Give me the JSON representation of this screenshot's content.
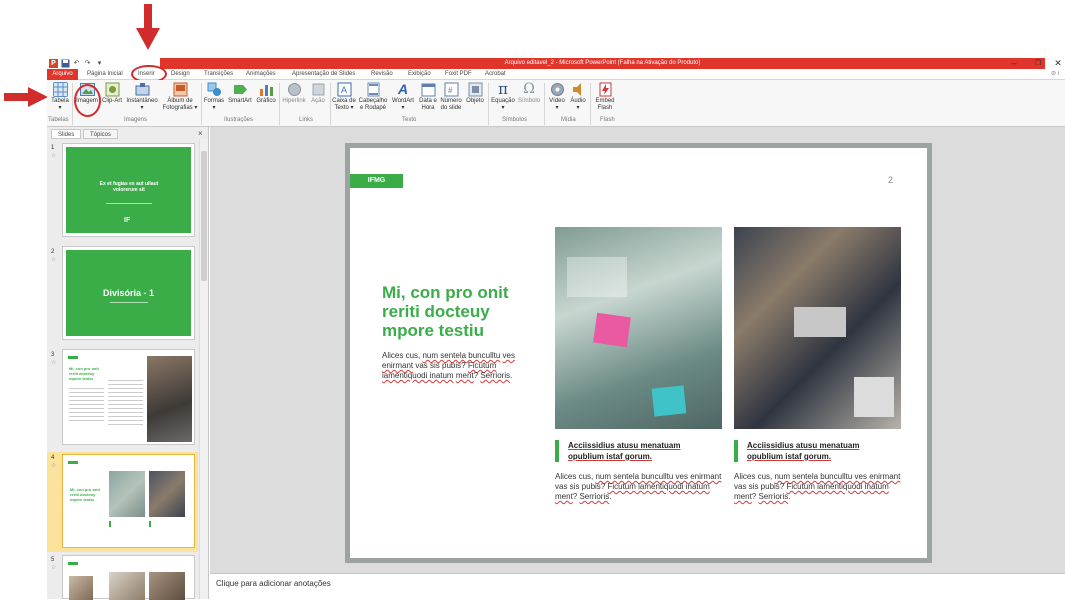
{
  "titlebar": {
    "title": "Arquivo editavel_2 - Microsoft PowerPoint (Falha na Ativação do Produto)",
    "icon_label": "P",
    "window_controls": [
      "–",
      "❐",
      "✕"
    ]
  },
  "tabs": [
    {
      "label": "Arquivo"
    },
    {
      "label": "Página Inicial"
    },
    {
      "label": "Inserir"
    },
    {
      "label": "Design"
    },
    {
      "label": "Transições"
    },
    {
      "label": "Animações"
    },
    {
      "label": "Apresentação de Slides"
    },
    {
      "label": "Revisão"
    },
    {
      "label": "Exibição"
    },
    {
      "label": "Foxit PDF"
    },
    {
      "label": "Acrobat"
    }
  ],
  "ribbon": {
    "buttons": [
      {
        "label": "Tabela",
        "sub": "▾",
        "icon": "table-icon",
        "color": "#5b8fc7"
      },
      {
        "label": "Imagem",
        "sub": "",
        "icon": "picture-icon",
        "color": "#6fa0d6"
      },
      {
        "label": "Clip-Art",
        "sub": "",
        "icon": "clipart-icon",
        "color": "#7d9b3c"
      },
      {
        "label": "Instantâneo",
        "sub": "▾",
        "icon": "screenshot-icon",
        "color": "#4a6fa5"
      },
      {
        "label": "Álbum de",
        "sub": "Fotografias ▾",
        "icon": "album-icon",
        "color": "#c95b2a"
      },
      {
        "label": "Formas",
        "sub": "▾",
        "icon": "shapes-icon",
        "color": "#3d8fcc"
      },
      {
        "label": "SmartArt",
        "sub": "",
        "icon": "smartart-icon",
        "color": "#4caf50"
      },
      {
        "label": "Gráfico",
        "sub": "",
        "icon": "chart-icon",
        "color": "#e0762f"
      },
      {
        "label": "Hiperlink",
        "sub": "",
        "icon": "hyperlink-icon",
        "color": "#9aa4ad"
      },
      {
        "label": "Ação",
        "sub": "",
        "icon": "action-icon",
        "color": "#9aa4ad"
      },
      {
        "label": "Caixa de",
        "sub": "Texto ▾",
        "icon": "textbox-icon",
        "color": "#3a6db5"
      },
      {
        "label": "Cabeçalho",
        "sub": "e Rodapé",
        "icon": "header-footer-icon",
        "color": "#6e8cb4"
      },
      {
        "label": "WordArt",
        "sub": "▾",
        "icon": "wordart-icon",
        "color": "#2f63b0"
      },
      {
        "label": "Data e",
        "sub": "Hora",
        "icon": "datetime-icon",
        "color": "#5c7fae"
      },
      {
        "label": "Número",
        "sub": "do slide",
        "icon": "slide-number-icon",
        "color": "#5c7fae"
      },
      {
        "label": "Objeto",
        "sub": "",
        "icon": "object-icon",
        "color": "#7b8fa8"
      },
      {
        "label": "Equação",
        "sub": "▾",
        "icon": "equation-icon",
        "color": "#2c4e86"
      },
      {
        "label": "Símbolo",
        "sub": "",
        "icon": "symbol-icon",
        "color": "#8c96a3"
      },
      {
        "label": "Vídeo",
        "sub": "▾",
        "icon": "video-icon",
        "color": "#6b7f95"
      },
      {
        "label": "Áudio",
        "sub": "▾",
        "icon": "audio-icon",
        "color": "#d08a2c"
      },
      {
        "label": "Embed",
        "sub": "Flash",
        "icon": "flash-icon",
        "color": "#c93a3a"
      }
    ],
    "groups": [
      "Tabelas",
      "Imagens",
      "Ilustrações",
      "Links",
      "Texto",
      "Símbolos",
      "Mídia",
      "Flash"
    ],
    "glyphs": {
      "equation": "π",
      "symbol": "Ω",
      "wordart": "A"
    }
  },
  "panel": {
    "tabs": [
      "Slides",
      "Tópicos"
    ],
    "close": "×",
    "thumbnails": [
      {
        "num": "1",
        "star": "☆",
        "title": "Ex et fugias es aut ullaut volorerum sit",
        "brand_mark": "IF"
      },
      {
        "num": "2",
        "star": "☆",
        "title": "Divisória - 1"
      },
      {
        "num": "3",
        "star": "☆",
        "title": "Mi, con pro onit reriti docteuy mpore testiu"
      },
      {
        "num": "4",
        "star": "☆",
        "title": "Mi, con pro onit reriti docteuy mpore testiu"
      },
      {
        "num": "5",
        "star": "☆",
        "title": ""
      }
    ]
  },
  "slide": {
    "tag": "IFMG",
    "page_number": "2",
    "headline": "Mi, con pro onit reriti docteuy mpore testiu",
    "body_parts": [
      "Alices cus, ",
      "num sentela bunculltu",
      "ves enirmant",
      " vas sis pubis? ",
      "Ficutum iamentiquodi inatum",
      "ment",
      "? ",
      "Serrioris",
      "."
    ],
    "cards": [
      {
        "heading": "Acciissidius atusu menatuam opublium istaf gorum.",
        "body_parts": [
          "Alices cus, ",
          "num sentela bunculltu ves enirmant",
          " vas sis pubis? ",
          "Ficutum iamentiquodi inatum",
          " ",
          "ment",
          "? ",
          "Serrioris",
          "."
        ]
      },
      {
        "heading": "Acciissidius atusu menatuam opublium istaf gorum.",
        "body_parts": [
          "Alices cus, ",
          "num sentela bunculltu ves enirmant",
          " vas sis pubis? ",
          "Ficutum iamentiquodi inatum",
          " ",
          "ment",
          "? ",
          "Serrioris",
          "."
        ]
      }
    ]
  },
  "notes": {
    "placeholder": "Clique para adicionar anotações"
  },
  "colors": {
    "accent_green": "#3aad49",
    "title_red": "#e0352b",
    "annotation_red": "#d12c2c"
  }
}
